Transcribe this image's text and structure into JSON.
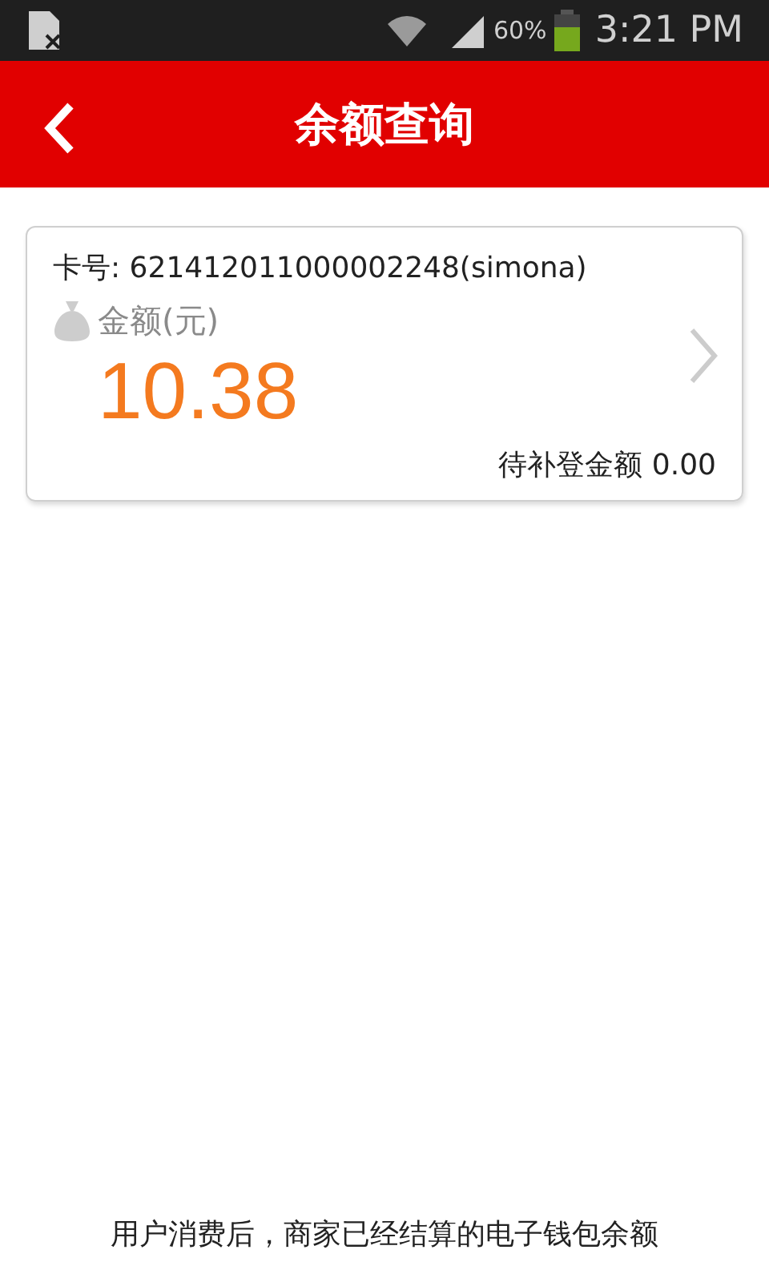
{
  "status_bar": {
    "battery": "60%",
    "time": "3:21 PM"
  },
  "header": {
    "title": "余额查询"
  },
  "card": {
    "card_number": "卡号: 621412011000002248(simona)",
    "amount_label": "金额(元)",
    "amount": "10.38",
    "pending": "待补登金额 0.00"
  },
  "footer_note": "用户消费后，商家已经结算的电子钱包余额"
}
